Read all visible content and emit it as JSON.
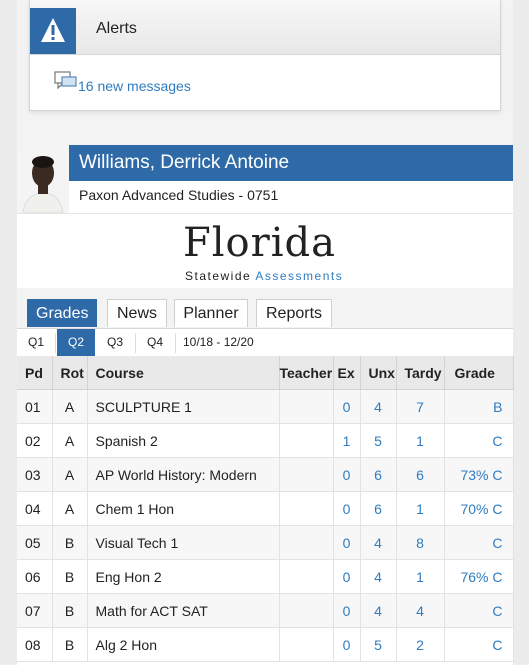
{
  "alerts": {
    "title": "Alerts",
    "messages_link": "16 new messages"
  },
  "student": {
    "name": "Williams, Derrick Antoine",
    "school": "Paxon Advanced Studies - 0751"
  },
  "logo": {
    "word": "Florida",
    "sub_a": "Statewide",
    "sub_b": "Assessments"
  },
  "tabs": [
    "Grades",
    "News",
    "Planner",
    "Reports"
  ],
  "quarters": [
    "Q1",
    "Q2",
    "Q3",
    "Q4"
  ],
  "active_quarter": "Q2",
  "date_range": "10/18 - 12/20",
  "table": {
    "headers": [
      "Pd",
      "Rot",
      "Course",
      "Teacher",
      "Ex",
      "Unx",
      "Tardy",
      "Grade"
    ],
    "rows": [
      {
        "pd": "01",
        "rot": "A",
        "course": "SCULPTURE 1",
        "teacher": "",
        "ex": "0",
        "unx": "4",
        "tardy": "7",
        "grade": "B"
      },
      {
        "pd": "02",
        "rot": "A",
        "course": "Spanish 2",
        "teacher": "",
        "ex": "1",
        "unx": "5",
        "tardy": "1",
        "grade": "C"
      },
      {
        "pd": "03",
        "rot": "A",
        "course": "AP World History: Modern",
        "teacher": "",
        "ex": "0",
        "unx": "6",
        "tardy": "6",
        "grade": "73% C"
      },
      {
        "pd": "04",
        "rot": "A",
        "course": "Chem 1 Hon",
        "teacher": "",
        "ex": "0",
        "unx": "6",
        "tardy": "1",
        "grade": "70% C"
      },
      {
        "pd": "05",
        "rot": "B",
        "course": "Visual Tech 1",
        "teacher": "",
        "ex": "0",
        "unx": "4",
        "tardy": "8",
        "grade": "C"
      },
      {
        "pd": "06",
        "rot": "B",
        "course": "Eng Hon 2",
        "teacher": "",
        "ex": "0",
        "unx": "4",
        "tardy": "1",
        "grade": "76% C"
      },
      {
        "pd": "07",
        "rot": "B",
        "course": "Math for ACT SAT",
        "teacher": "",
        "ex": "0",
        "unx": "4",
        "tardy": "4",
        "grade": "C"
      },
      {
        "pd": "08",
        "rot": "B",
        "course": "Alg 2 Hon",
        "teacher": "",
        "ex": "0",
        "unx": "5",
        "tardy": "2",
        "grade": "C"
      }
    ]
  },
  "colors": {
    "accent": "#2f6aa8",
    "link": "#2f7cc0"
  },
  "icons": {
    "alert": "warning-triangle-icon",
    "message": "message-bubbles-icon"
  }
}
